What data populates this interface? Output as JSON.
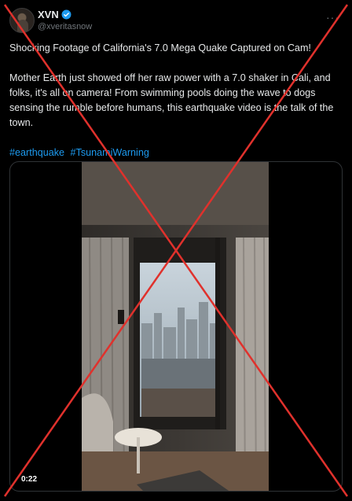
{
  "post": {
    "display_name": "XVN",
    "handle": "@xveritasnow",
    "more_label": "···",
    "headline": "Shocking Footage of California's 7.0 Mega Quake Captured on Cam!",
    "body": "Mother Earth just showed off her raw power with a 7.0 shaker in Cali, and folks, it's all on camera! From swimming pools doing the wave to dogs sensing the rumble before humans, this earthquake video is the talk of the town.",
    "hashtags": [
      "#earthquake",
      "#TsunamiWarning"
    ]
  },
  "video": {
    "timestamp": "0:22"
  },
  "colors": {
    "background": "#000000",
    "text": "#e7e9ea",
    "secondary_text": "#71767b",
    "link": "#1d9bf0",
    "verified_badge": "#1d9bf0",
    "cross_mark": "#e0312c"
  },
  "icons": {
    "verified": "verified-badge-icon",
    "more": "more-options-icon",
    "cross": "false-claim-cross-icon"
  }
}
